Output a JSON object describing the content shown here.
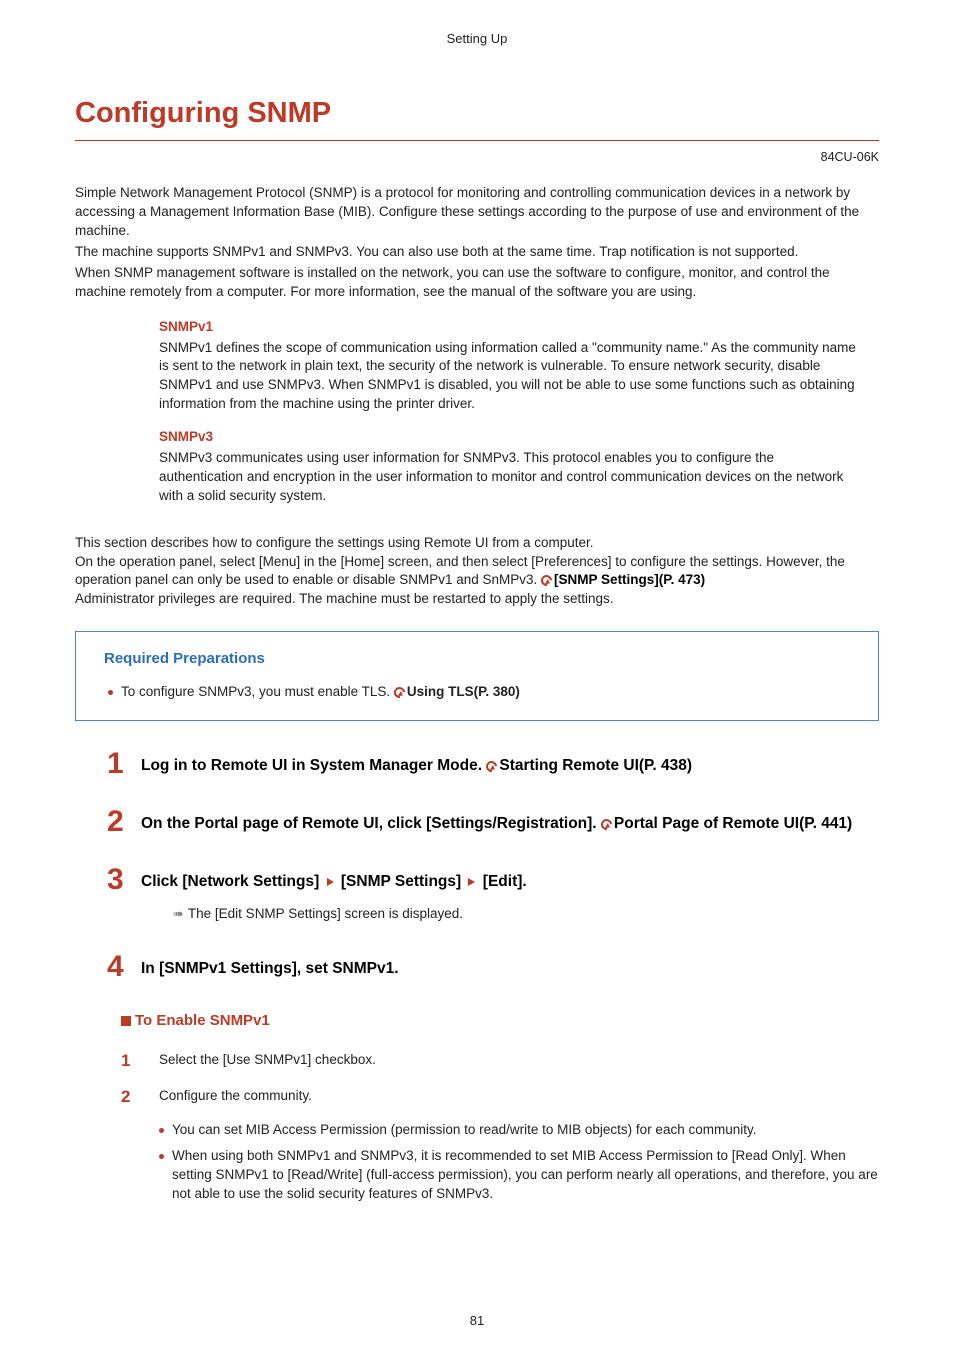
{
  "header": "Setting Up",
  "title": "Configuring SNMP",
  "doc_code": "84CU-06K",
  "intro": {
    "p1": "Simple Network Management Protocol (SNMP) is a protocol for monitoring and controlling communication devices in a network by accessing a Management Information Base (MIB). Configure these settings according to the purpose of use and environment of the machine.",
    "p2": "The machine supports SNMPv1 and SNMPv3. You can also use both at the same time. Trap notification is not supported.",
    "p3": "When SNMP management software is installed on the network, you can use the software to configure, monitor, and control the machine remotely from a computer. For more information, see the manual of the software you are using."
  },
  "protocols": [
    {
      "name": "SNMPv1",
      "desc": "SNMPv1 defines the scope of communication using information called a \"community name.\" As the community name is sent to the network in plain text, the security of the network is vulnerable. To ensure network security, disable SNMPv1 and use SNMPv3. When SNMPv1 is disabled, you will not be able to use some functions such as obtaining information from the machine using the printer driver."
    },
    {
      "name": "SNMPv3",
      "desc": "SNMPv3 communicates using user information for SNMPv3. This protocol enables you to configure the authentication and encryption in the user information to monitor and control communication devices on the network with a solid security system."
    }
  ],
  "section_note": {
    "l1": "This section describes how to configure the settings using Remote UI from a computer.",
    "l2a": "On the operation panel, select [Menu] in the [Home] screen, and then select [Preferences] to configure the settings. However, the operation panel can only be used to enable or disable SNMPv1 and SnMPv3. ",
    "l2_link": "[SNMP Settings](P. 473)",
    "l3": "Administrator privileges are required. The machine must be restarted to apply the settings."
  },
  "prep": {
    "title": "Required Preparations",
    "text": "To configure SNMPv3, you must enable TLS. ",
    "link": "Using TLS(P. 380)"
  },
  "steps": [
    {
      "num": "1",
      "text": "Log in to Remote UI in System Manager Mode. ",
      "link": "Starting Remote UI(P. 438)"
    },
    {
      "num": "2",
      "text": "On the Portal page of Remote UI, click [Settings/Registration]. ",
      "link": "Portal Page of Remote UI(P. 441)"
    },
    {
      "num": "3",
      "pre": "Click [Network Settings] ",
      "mid": " [SNMP Settings] ",
      "post": " [Edit].",
      "result": "The [Edit SNMP Settings] screen is displayed."
    },
    {
      "num": "4",
      "text": "In [SNMPv1 Settings], set SNMPv1."
    }
  ],
  "subsection": {
    "title": "To Enable SNMPv1",
    "items": [
      {
        "num": "1",
        "text": "Select the [Use SNMPv1] checkbox."
      },
      {
        "num": "2",
        "text": "Configure the community."
      }
    ],
    "bullets": [
      "You can set MIB Access Permission (permission to read/write to MIB objects) for each community.",
      "When using both SNMPv1 and SNMPv3, it is recommended to set MIB Access Permission to [Read Only]. When setting SNMPv1 to [Read/Write] (full-access permission), you can perform nearly all operations, and therefore, you are not able to use the solid security features of SNMPv3."
    ]
  },
  "page_number": "81"
}
